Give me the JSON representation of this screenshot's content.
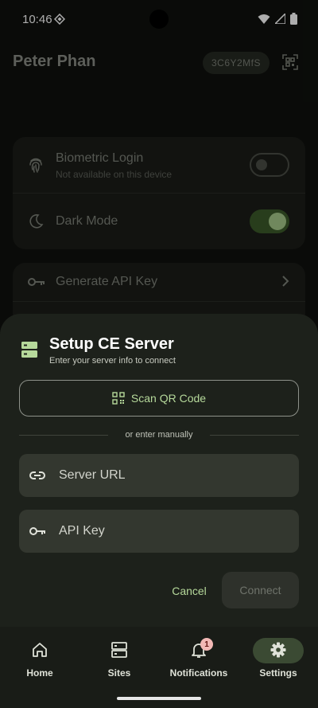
{
  "status_bar": {
    "time": "10:46"
  },
  "profile": {
    "name": "Peter Phan",
    "id": "3C6Y2MfS"
  },
  "settings": {
    "biometric": {
      "title": "Biometric Login",
      "subtitle": "Not available on this device",
      "enabled": false
    },
    "dark_mode": {
      "title": "Dark Mode",
      "enabled": true
    },
    "generate_api_key": {
      "title": "Generate API Key"
    }
  },
  "sheet": {
    "title": "Setup CE Server",
    "subtitle": "Enter your server info to connect",
    "scan_label": "Scan QR Code",
    "divider_text": "or enter manually",
    "server_url_placeholder": "Server URL",
    "api_key_placeholder": "API Key",
    "cancel_label": "Cancel",
    "connect_label": "Connect"
  },
  "nav": {
    "items": [
      {
        "label": "Home",
        "icon": "home-icon"
      },
      {
        "label": "Sites",
        "icon": "sites-icon"
      },
      {
        "label": "Notifications",
        "icon": "bell-icon",
        "badge": "1"
      },
      {
        "label": "Settings",
        "icon": "gear-icon",
        "selected": true
      }
    ]
  },
  "colors": {
    "accent": "#b6d99b",
    "sheet_bg": "#1d211b",
    "badge": "#f2b8b5"
  }
}
